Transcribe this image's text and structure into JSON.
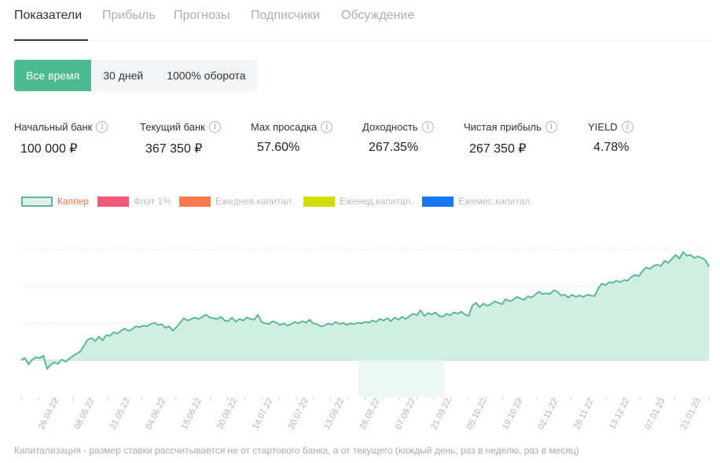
{
  "tabs": [
    {
      "label": "Показатели",
      "active": true
    },
    {
      "label": "Прибыль",
      "active": false
    },
    {
      "label": "Прогнозы",
      "active": false
    },
    {
      "label": "Подписчики",
      "active": false
    },
    {
      "label": "Обсуждение",
      "active": false
    }
  ],
  "periods": [
    {
      "label": "Все время",
      "active": true
    },
    {
      "label": "30 дней",
      "active": false
    },
    {
      "label": "1000% оборота",
      "active": false
    }
  ],
  "stats": [
    {
      "label": "Начальный банк",
      "value": "100 000 ₽"
    },
    {
      "label": "Текущий банк",
      "value": "367 350 ₽"
    },
    {
      "label": "Max просадка",
      "value": "57.60%"
    },
    {
      "label": "Доходность",
      "value": "267.35%"
    },
    {
      "label": "Чистая прибыль",
      "value": "267 350 ₽"
    },
    {
      "label": "YIELD",
      "value": "4.78%"
    }
  ],
  "info_icon_glyph": "i",
  "legend": [
    {
      "label": "Каппер",
      "color": "#5cb896"
    },
    {
      "label": "Флэт 1%",
      "color": "#f2587a"
    },
    {
      "label": "Ежеднев.капитал.",
      "color": "#ff7a4d"
    },
    {
      "label": "Еженед.капитал.",
      "color": "#d4dc00"
    },
    {
      "label": "Ежемес.капитал.",
      "color": "#1877f2"
    }
  ],
  "chart_data": {
    "type": "area",
    "series": [
      {
        "name": "Каппер",
        "color": "#5cb896",
        "fill": "#cdeee0",
        "values": [
          0,
          0.3,
          -0.6,
          0.1,
          0.4,
          0.3,
          0.6,
          -1.2,
          -0.6,
          -0.3,
          -0.5,
          0.1,
          -0.2,
          0.2,
          0.6,
          0.9,
          1.2,
          2.0,
          2.8,
          3.0,
          2.6,
          3.2,
          2.7,
          3.4,
          3.3,
          3.8,
          3.6,
          4.0,
          4.3,
          4.0,
          4.2,
          4.6,
          4.5,
          4.7,
          4.6,
          4.9,
          5.1,
          4.8,
          4.9,
          4.4,
          4.6,
          4.0,
          4.5,
          5.1,
          5.7,
          5.4,
          5.6,
          5.8,
          5.6,
          5.9,
          6.2,
          5.8,
          5.7,
          5.6,
          5.9,
          5.4,
          5.3,
          5.8,
          5.2,
          5.6,
          5.4,
          5.8,
          5.6,
          5.5,
          6.2,
          5.2,
          5.0,
          4.9,
          5.3,
          5.1,
          4.8,
          5.0,
          4.7,
          4.9,
          5.2,
          5.0,
          5.3,
          5.1,
          5.5,
          5.0,
          4.9,
          4.6,
          4.7,
          5.0,
          4.8,
          5.2,
          4.9,
          5.1,
          4.8,
          5.0,
          4.9,
          5.1,
          5.0,
          5.2,
          5.1,
          5.4,
          5.2,
          5.6,
          5.4,
          5.7,
          5.3,
          5.8,
          5.5,
          5.9,
          5.6,
          6.0,
          6.3,
          6.1,
          6.8,
          6.0,
          6.4,
          6.2,
          6.5,
          6.0,
          5.9,
          6.3,
          6.1,
          6.5,
          6.3,
          6.6,
          6.2,
          6.0,
          7.4,
          7.8,
          7.2,
          7.7,
          7.4,
          7.6,
          8.0,
          7.8,
          7.6,
          8.3,
          8.0,
          8.2,
          8.6,
          8.4,
          8.2,
          8.7,
          8.5,
          8.9,
          9.3,
          9.0,
          9.1,
          9.0,
          9.5,
          9.3,
          8.8,
          8.9,
          8.5,
          8.9,
          8.6,
          8.8,
          8.6,
          8.9,
          8.8,
          8.7,
          9.7,
          10.4,
          10.2,
          10.6,
          10.5,
          10.8,
          10.6,
          10.9,
          10.8,
          11.3,
          11.6,
          11.4,
          12.1,
          12.6,
          12.4,
          12.8,
          13.0,
          12.8,
          13.5,
          13.2,
          13.8,
          14.3,
          13.8,
          14.7,
          14.2,
          14.3,
          13.9,
          14.1,
          13.9,
          13.6,
          12.7
        ]
      }
    ],
    "x_tick_labels": [
      "26.04.22",
      "08.05.22",
      "21.05.22",
      "04.06.22",
      "18.06.22",
      "30.06.22",
      "14.07.22",
      "30.07.22",
      "13.08.22",
      "26.08.22",
      "07.09.22",
      "21.09.22",
      "05.10.22",
      "19.10.22",
      "02.11.22",
      "26.11.22",
      "13.12.22",
      "07.01.23",
      "21.01.23"
    ],
    "ylim": [
      -5,
      20
    ],
    "y_gridlines": [
      0,
      5,
      10,
      15
    ],
    "highlight_band": [
      0.49,
      0.615
    ]
  },
  "footnote": "Капитализация - размер ставки рассчитывается не от стартового банка, а от текущего (каждый день, раз в неделю, раз в месяц)"
}
